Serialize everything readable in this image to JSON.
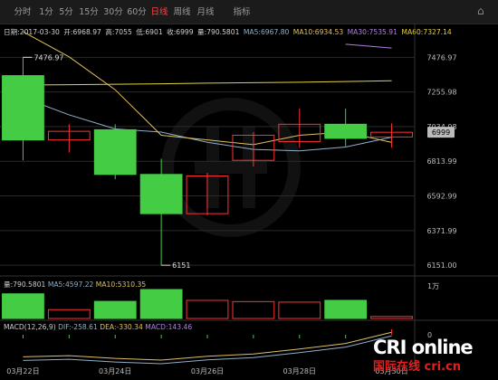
{
  "tabs": [
    {
      "label": "分时"
    },
    {
      "label": "1分"
    },
    {
      "label": "5分"
    },
    {
      "label": "15分"
    },
    {
      "label": "30分"
    },
    {
      "label": "60分"
    },
    {
      "label": "日线",
      "active": true
    },
    {
      "label": "周线"
    },
    {
      "label": "月线"
    },
    {
      "label": "指标"
    }
  ],
  "info": {
    "date": "日期:2017-03-30",
    "open": "开:6968.97",
    "high": "高:7055",
    "low": "低:6901",
    "close": "收:6999",
    "vol": "量:790.5801",
    "ma5": "MA5:6967.80",
    "ma10": "MA10:6934.53",
    "ma30": "MA30:7535.91",
    "ma60": "MA60:7327.14"
  },
  "volume_info": {
    "vol": "量:790.5801",
    "ma5": "MA5:4597.22",
    "ma10": "MA10:5310.35"
  },
  "macd_info": {
    "label": "MACD(12,26,9)",
    "dif": "DIF:-258.61",
    "dea": "DEA:-330.34",
    "macd": "MACD:143.46"
  },
  "colors": {
    "up": "#ff3232",
    "down": "#44cc44",
    "ma5": "#8fb0c8",
    "ma10": "#e0c060",
    "ma30": "#b080e0",
    "ma60": "#e0d040"
  },
  "chart_data": {
    "type": "candlestick",
    "ylim": [
      6100,
      7600
    ],
    "yticks": [
      "7476.97",
      "7255.98",
      "7034.98",
      "6813.99",
      "6592.99",
      "6371.99",
      "6151.00"
    ],
    "ytick_values": [
      7476.97,
      7255.98,
      7034.98,
      6813.99,
      6592.99,
      6371.99,
      6151.0
    ],
    "last_price_label": "6999",
    "xticks": [
      "03月22日",
      "03月24日",
      "03月26日",
      "03月28日",
      "03月30日"
    ],
    "xtick_index": [
      0,
      2,
      4,
      6,
      8
    ],
    "annotations": [
      {
        "text": "7476.97",
        "index": 0,
        "value": 7476.97
      },
      {
        "text": "6151",
        "index": 3,
        "value": 6151
      }
    ],
    "candles": [
      {
        "o": 7360,
        "h": 7476.97,
        "l": 6820,
        "c": 6950,
        "dir": "down"
      },
      {
        "o": 6950,
        "h": 7050,
        "l": 6870,
        "c": 7005,
        "dir": "up"
      },
      {
        "o": 7015,
        "h": 7050,
        "l": 6700,
        "c": 6730,
        "dir": "down"
      },
      {
        "o": 6730,
        "h": 6830,
        "l": 6151,
        "c": 6480,
        "dir": "down"
      },
      {
        "o": 6480,
        "h": 6740,
        "l": 6470,
        "c": 6720,
        "dir": "up"
      },
      {
        "o": 6820,
        "h": 7000,
        "l": 6780,
        "c": 6980,
        "dir": "up"
      },
      {
        "o": 6940,
        "h": 7150,
        "l": 6900,
        "c": 7050,
        "dir": "up"
      },
      {
        "o": 7050,
        "h": 7150,
        "l": 6910,
        "c": 6960,
        "dir": "down"
      },
      {
        "o": 6968.97,
        "h": 7055,
        "l": 6901,
        "c": 6999,
        "dir": "up"
      }
    ],
    "ma5": [
      7220,
      7110,
      7020,
      7000,
      6935,
      6890,
      6880,
      6905,
      6967.8
    ],
    "ma10": [
      7640,
      7480,
      7270,
      6980,
      6950,
      6920,
      6980,
      7000,
      6934.53
    ],
    "ma30": [
      null,
      null,
      null,
      null,
      null,
      null,
      null,
      7560,
      7535.91
    ],
    "ma60": [
      7300,
      7302,
      7305,
      7308,
      7312,
      7315,
      7318,
      7322,
      7327.14
    ],
    "volume": [
      {
        "v": 9800,
        "dir": "down"
      },
      {
        "v": 3500,
        "dir": "up"
      },
      {
        "v": 6800,
        "dir": "down"
      },
      {
        "v": 11500,
        "dir": "down"
      },
      {
        "v": 7200,
        "dir": "up"
      },
      {
        "v": 6700,
        "dir": "up"
      },
      {
        "v": 6500,
        "dir": "up"
      },
      {
        "v": 7200,
        "dir": "down"
      },
      {
        "v": 790.5801,
        "dir": "up"
      }
    ],
    "volume_ylabel": "1万",
    "macd": [
      -300,
      -280,
      -330,
      -360,
      -290,
      -250,
      -160,
      -60,
      143.46
    ],
    "macd_ylabel": "0"
  },
  "watermark": "CRI online",
  "watermark2": "国际在线 cri.cn"
}
